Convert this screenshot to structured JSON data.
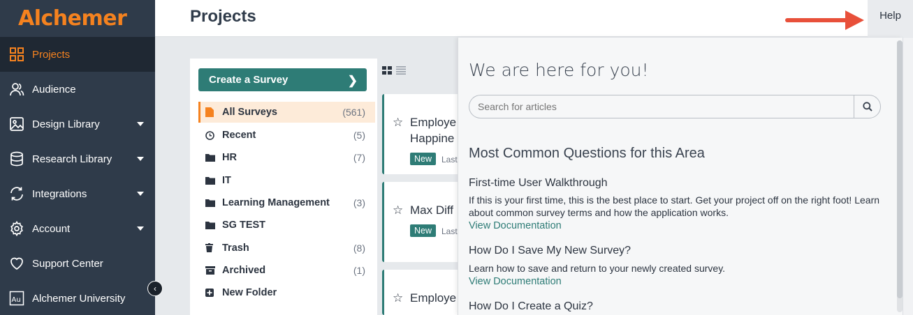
{
  "app": {
    "logo": "Alchemer"
  },
  "sidebar": {
    "items": [
      {
        "label": "Projects",
        "icon": "grid-icon",
        "active": true,
        "caret": false
      },
      {
        "label": "Audience",
        "icon": "users-icon",
        "active": false,
        "caret": false
      },
      {
        "label": "Design Library",
        "icon": "image-icon",
        "active": false,
        "caret": true
      },
      {
        "label": "Research Library",
        "icon": "database-icon",
        "active": false,
        "caret": true
      },
      {
        "label": "Integrations",
        "icon": "sync-icon",
        "active": false,
        "caret": true
      },
      {
        "label": "Account",
        "icon": "gear-icon",
        "active": false,
        "caret": true
      },
      {
        "label": "Support Center",
        "icon": "heart-icon",
        "active": false,
        "caret": false
      },
      {
        "label": "Alchemer University",
        "icon": "au-icon",
        "active": false,
        "caret": false
      }
    ]
  },
  "header": {
    "title": "Projects",
    "help_label": "Help"
  },
  "folders": {
    "create_label": "Create a Survey",
    "items": [
      {
        "label": "All Surveys",
        "count": "(561)",
        "icon": "file-icon"
      },
      {
        "label": "Recent",
        "count": "(5)",
        "icon": "clock-icon"
      },
      {
        "label": "HR",
        "count": "(7)",
        "icon": "folder-icon"
      },
      {
        "label": "IT",
        "count": "",
        "icon": "folder-icon"
      },
      {
        "label": "Learning Management",
        "count": "(3)",
        "icon": "folder-icon"
      },
      {
        "label": "SG TEST",
        "count": "",
        "icon": "folder-icon"
      },
      {
        "label": "Trash",
        "count": "(8)",
        "icon": "trash-icon"
      },
      {
        "label": "Archived",
        "count": "(1)",
        "icon": "archive-icon"
      },
      {
        "label": "New Folder",
        "count": "",
        "icon": "plus-icon"
      }
    ]
  },
  "cards": [
    {
      "title_line1": "Employe",
      "title_line2": "Happine",
      "badge": "New",
      "last": "Last"
    },
    {
      "title_line1": "Max Diff",
      "badge": "New",
      "last": "Last"
    },
    {
      "title_line1": "Employe"
    }
  ],
  "help": {
    "heading": "We are here for you!",
    "search_placeholder": "Search for articles",
    "common_heading": "Most Common Questions for this Area",
    "questions": [
      {
        "title": "First-time User Walkthrough",
        "desc": "If this is your first time, this is the best place to start. Get your project off on the right foot! Learn about common survey terms and how the application works.",
        "link": "View Documentation"
      },
      {
        "title": "How Do I Save My New Survey?",
        "desc": "Learn how to save and return to your newly created survey.",
        "link": "View Documentation"
      },
      {
        "title": "How Do I Create a Quiz?"
      }
    ]
  },
  "colors": {
    "brand_orange": "#f5821f",
    "teal": "#2e7c76",
    "sidebar": "#2f3b4a",
    "arrow_red": "#e8503a"
  }
}
